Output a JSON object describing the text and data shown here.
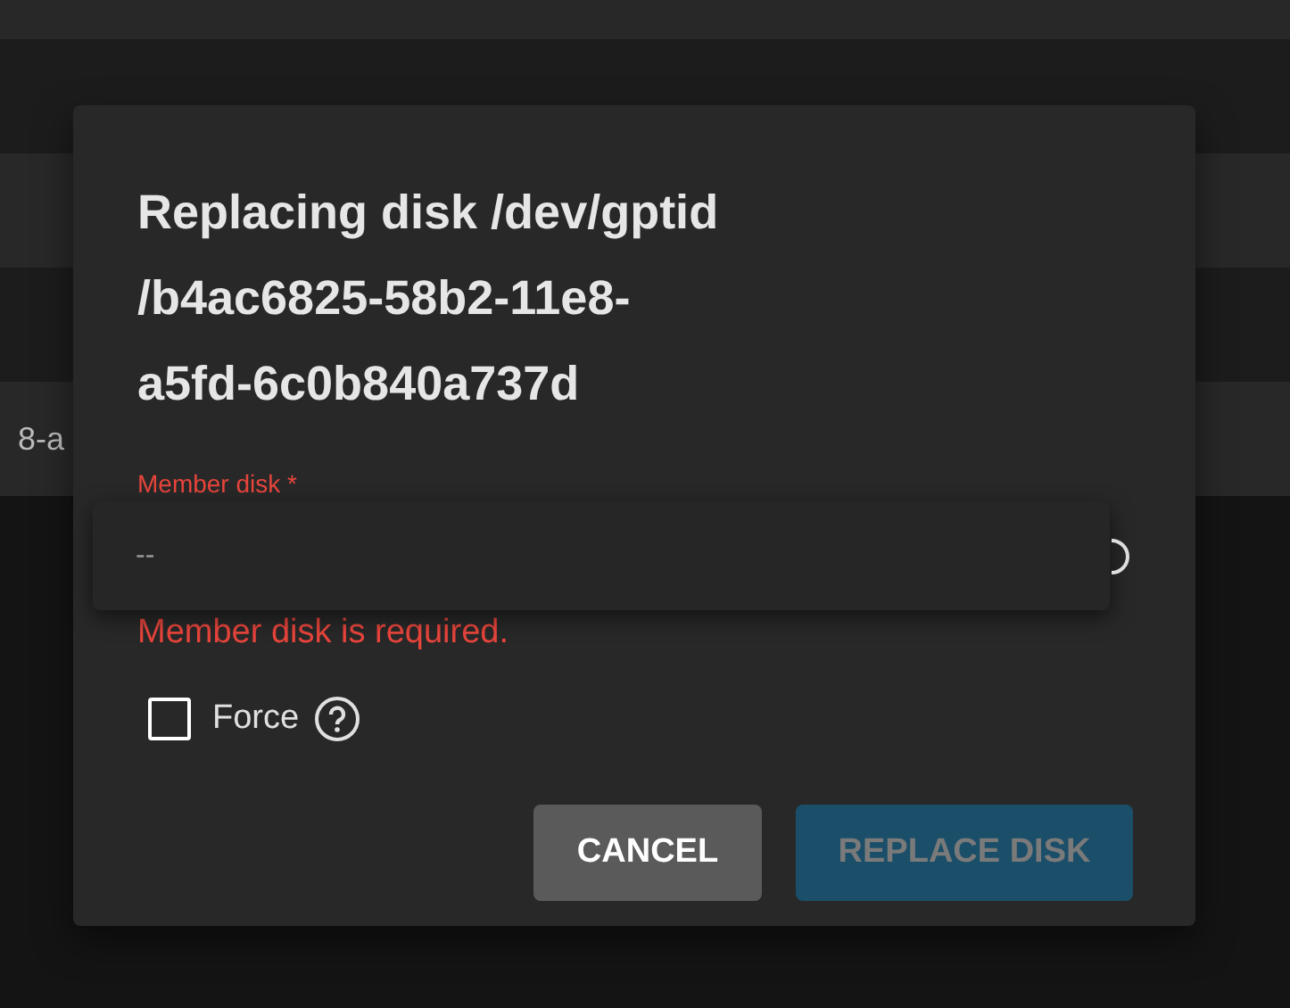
{
  "background_table": {
    "rows": [
      {
        "kind": "light"
      },
      {
        "kind": "dark"
      },
      {
        "kind": "light"
      },
      {
        "kind": "dark"
      },
      {
        "kind": "light",
        "text": "8-a"
      }
    ]
  },
  "dialog": {
    "title_lines": [
      "Replacing disk /dev/gptid",
      "/b4ac6825-58b2-11e8-",
      "a5fd-6c0b840a737d"
    ],
    "field": {
      "label": "Member disk *",
      "error": "Member disk is required."
    },
    "dropdown_options": [
      {
        "label": "--"
      }
    ],
    "force": {
      "label": "Force",
      "checked": false
    },
    "buttons": [
      {
        "label": "CANCEL",
        "kind": "secondary",
        "disabled": false
      },
      {
        "label": "REPLACE DISK",
        "kind": "primary",
        "disabled": true
      }
    ]
  }
}
